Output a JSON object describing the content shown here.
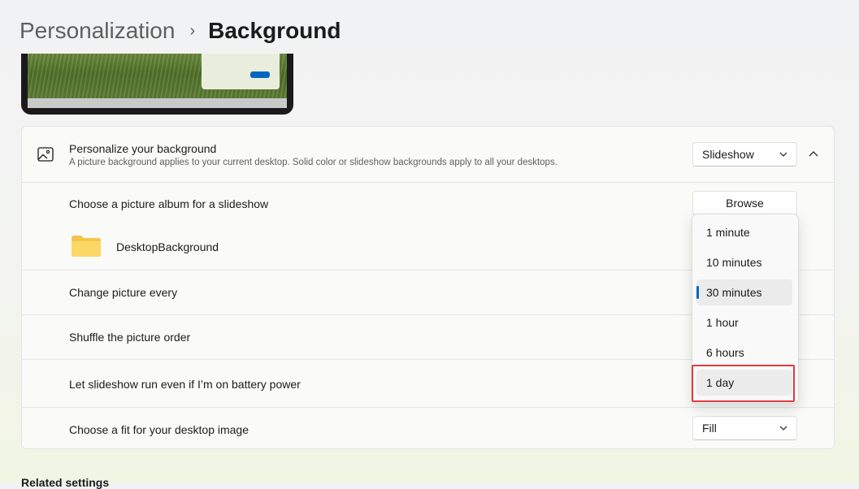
{
  "header": {
    "parent": "Personalization",
    "separator": "›",
    "current": "Background"
  },
  "background_section": {
    "title": "Personalize your background",
    "subtitle": "A picture background applies to your current desktop. Solid color or slideshow backgrounds apply to all your desktops.",
    "type_select": "Slideshow",
    "icon": "image-icon",
    "collapse_icon": "chevron-up-icon"
  },
  "rows": {
    "album_label": "Choose a picture album for a slideshow",
    "browse_label": "Browse",
    "folder_name": "DesktopBackground",
    "folder_icon": "folder-icon",
    "change_label": "Change picture every",
    "shuffle_label": "Shuffle the picture order",
    "battery_label": "Let slideshow run even if I’m on battery power",
    "fit_label": "Choose a fit for your desktop image",
    "fit_select": "Fill"
  },
  "interval_dropdown": {
    "options": [
      "1 minute",
      "10 minutes",
      "30 minutes",
      "1 hour",
      "6 hours",
      "1 day"
    ],
    "selected": "30 minutes",
    "highlighted": "1 day"
  },
  "related": {
    "title": "Related settings"
  },
  "colors": {
    "accent": "#0067c0",
    "highlight_box": "#e0393e"
  }
}
